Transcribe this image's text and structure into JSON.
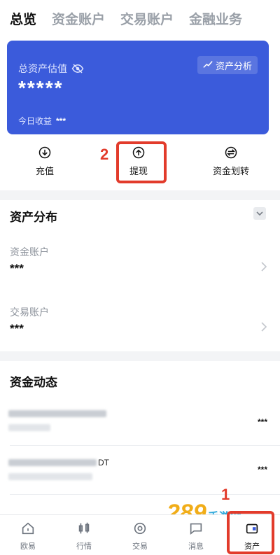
{
  "tabs": [
    "总览",
    "资金账户",
    "交易账户",
    "金融业务"
  ],
  "asset_card": {
    "label": "总资产估值",
    "value": "*****",
    "analysis_button": "资产分析",
    "today_label": "今日收益",
    "today_value": "***"
  },
  "actions": {
    "deposit": "充值",
    "withdraw": "提现",
    "transfer": "资金划转"
  },
  "annotations": {
    "mark_withdraw": "2",
    "mark_assets": "1"
  },
  "distribution": {
    "title": "资产分布",
    "accounts": [
      {
        "label": "资金账户",
        "value": "***"
      },
      {
        "label": "交易账户",
        "value": "***"
      }
    ]
  },
  "funds_flow": {
    "title": "资金动态",
    "rows": [
      {
        "value": "***"
      },
      {
        "value": "***",
        "partial_label": "DT"
      }
    ]
  },
  "watermark": {
    "main": "289",
    "sub": "手游网"
  },
  "bottom_nav": [
    "欧易",
    "行情",
    "交易",
    "消息",
    "资产"
  ],
  "colors": {
    "card_blue": "#3b5bdb",
    "annotation_red": "#e23b2b"
  }
}
